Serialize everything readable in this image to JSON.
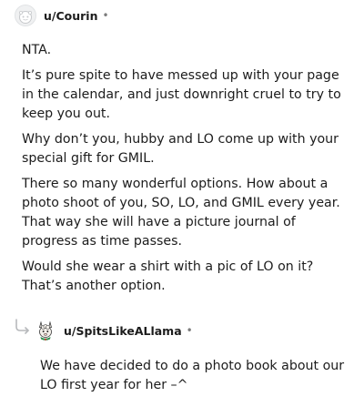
{
  "comment": {
    "username": "u/Courin",
    "separator": "•",
    "avatar_icon": "default-snoo-avatar",
    "paragraphs": [
      "NTA.",
      "It’s pure spite to have messed up with your page in the calendar, and just downright cruel to try to keep you out.",
      "Why don’t you, hubby and LO come up with your special gift for GMIL.",
      "There so many wonderful options. How about a photo shoot of you, SO, LO, and GMIL every year. That way she will have a picture journal of progress as time passes.",
      "Would she wear a shirt with a pic of LO on it? That’s another option."
    ]
  },
  "reply": {
    "connector_icon": "reply-arrow-icon",
    "username": "u/SpitsLikeALlama",
    "separator": "•",
    "avatar_icon": "llama-avatar",
    "text": "We have decided to do a photo book about our LO first year for her –^"
  }
}
